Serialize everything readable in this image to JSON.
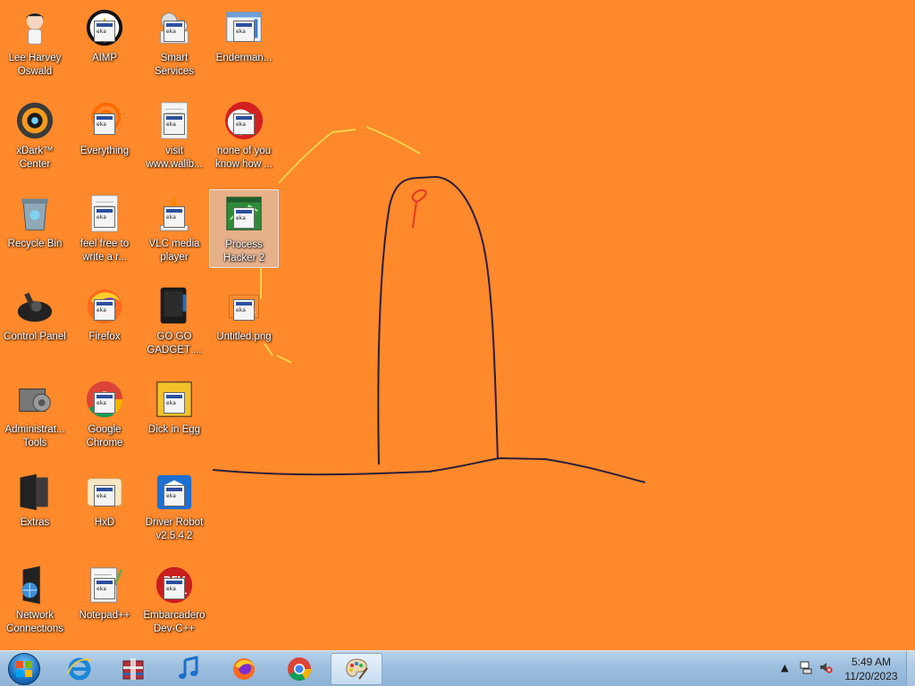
{
  "desktop": {
    "background_color": "#ff892b",
    "icons": [
      {
        "id": "lee-harvey-oswald",
        "label": "Lee Harvey\nOswald",
        "kind": "avatar"
      },
      {
        "id": "aimp",
        "label": "AIMP",
        "kind": "aimp"
      },
      {
        "id": "smart-services",
        "label": "Smart\nServices",
        "kind": "gears"
      },
      {
        "id": "enderman",
        "label": "Enderman...",
        "kind": "window"
      },
      {
        "id": "xdark-center",
        "label": "xDark™\nCenter",
        "kind": "xdark"
      },
      {
        "id": "everything",
        "label": "Everything",
        "kind": "everything"
      },
      {
        "id": "visit-wallb",
        "label": "visit\nwww.wallb...",
        "kind": "textfile"
      },
      {
        "id": "none-of-you",
        "label": "none of you\nknow how ...",
        "kind": "redcircle"
      },
      {
        "id": "recycle-bin",
        "label": "Recycle Bin",
        "kind": "recycle"
      },
      {
        "id": "feel-free",
        "label": "feel free to\nwrite a r...",
        "kind": "textfile"
      },
      {
        "id": "vlc",
        "label": "VLC media\nplayer",
        "kind": "vlc"
      },
      {
        "id": "process-hacker",
        "label": "Process\nHacker 2",
        "kind": "processhacker",
        "selected": true
      },
      {
        "id": "control-panel",
        "label": "Control Panel",
        "kind": "controlpanel"
      },
      {
        "id": "firefox",
        "label": "Firefox",
        "kind": "firefox"
      },
      {
        "id": "go-go-gadget",
        "label": "GO GO\nGADGET ...",
        "kind": "blackdevice"
      },
      {
        "id": "untitled-png",
        "label": "Untitled.png",
        "kind": "png"
      },
      {
        "id": "admin-tools",
        "label": "Administrat...\nTools",
        "kind": "admintools"
      },
      {
        "id": "google-chrome",
        "label": "Google\nChrome",
        "kind": "chrome"
      },
      {
        "id": "dick-in-egg",
        "label": "Dick in Egg",
        "kind": "egg"
      },
      {
        "id": "extras",
        "label": "Extras",
        "kind": "folderdark"
      },
      {
        "id": "hxd",
        "label": "HxD",
        "kind": "hxd"
      },
      {
        "id": "driver-robot",
        "label": "Driver Robot\nv2.5.4.2",
        "kind": "driverrobot"
      },
      {
        "id": "network-connections",
        "label": "Network\nConnections",
        "kind": "network"
      },
      {
        "id": "notepad-plus-plus",
        "label": "Notepad++",
        "kind": "notepad"
      },
      {
        "id": "embarcadero-devcpp",
        "label": "Embarcadero\nDev-C++",
        "kind": "devcpp"
      }
    ]
  },
  "taskbar": {
    "pinned": [
      {
        "id": "internet-explorer",
        "icon": "internet-explorer-icon"
      },
      {
        "id": "archive-tool",
        "icon": "archive-icon"
      },
      {
        "id": "music-player",
        "icon": "music-note-icon"
      },
      {
        "id": "firefox",
        "icon": "firefox-icon"
      },
      {
        "id": "chrome",
        "icon": "chrome-icon"
      },
      {
        "id": "paint",
        "icon": "paint-palette-icon",
        "active": true
      }
    ],
    "tray": {
      "time": "5:49 AM",
      "date": "11/20/2023"
    }
  }
}
